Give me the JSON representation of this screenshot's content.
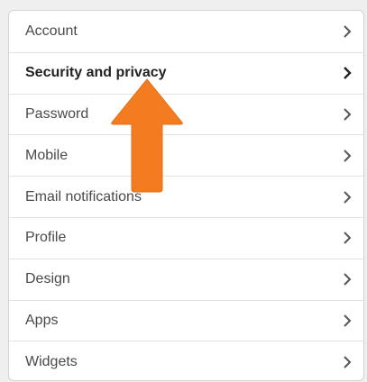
{
  "menu": {
    "items": [
      {
        "label": "Account",
        "active": false
      },
      {
        "label": "Security and privacy",
        "active": true
      },
      {
        "label": "Password",
        "active": false
      },
      {
        "label": "Mobile",
        "active": false
      },
      {
        "label": "Email notifications",
        "active": false
      },
      {
        "label": "Profile",
        "active": false
      },
      {
        "label": "Design",
        "active": false
      },
      {
        "label": "Apps",
        "active": false
      },
      {
        "label": "Widgets",
        "active": false
      }
    ],
    "chevron_icon": "chevron-right-icon"
  },
  "annotation": {
    "icon": "up-arrow-icon",
    "color": "#f47c20"
  },
  "colors": {
    "panel_background": "#ffffff",
    "divider": "#e2e2e2",
    "text": "#4a4a4a",
    "active_text": "#222222",
    "chevron": "#555555"
  }
}
